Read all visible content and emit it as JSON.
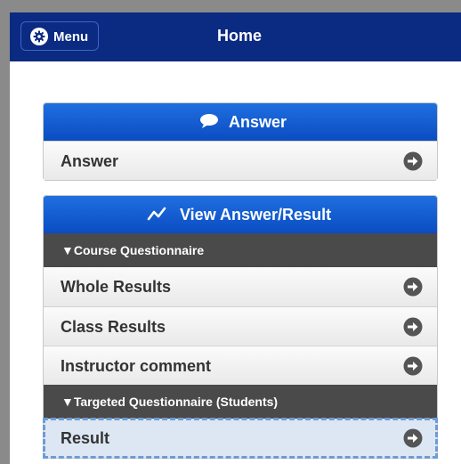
{
  "header": {
    "menu_label": "Menu",
    "title": "Home"
  },
  "answer_panel": {
    "title": "Answer",
    "icon": "speech-bubble-icon",
    "items": [
      {
        "label": "Answer"
      }
    ]
  },
  "view_panel": {
    "title": "View Answer/Result",
    "icon": "line-chart-icon",
    "sections": [
      {
        "title": "▼Course Questionnaire",
        "items": [
          {
            "label": "Whole Results"
          },
          {
            "label": "Class Results"
          },
          {
            "label": "Instructor comment"
          }
        ]
      },
      {
        "title": "▼Targeted Questionnaire (Students)",
        "items": [
          {
            "label": "Result",
            "selected": true
          }
        ]
      }
    ]
  },
  "colors": {
    "header_bg": "#0b2a82",
    "panel_head": "#1560d6",
    "section_bg": "#4a4a4a",
    "selected_outline": "#6f9bd4"
  }
}
